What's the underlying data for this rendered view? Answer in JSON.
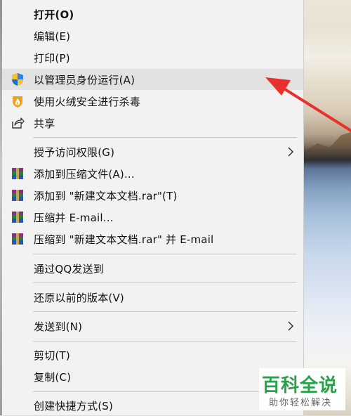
{
  "menu": {
    "items": [
      {
        "label": "打开(O)"
      },
      {
        "label": "编辑(E)"
      },
      {
        "label": "打印(P)"
      },
      {
        "label": "以管理员身份运行(A)"
      },
      {
        "label": "使用火绒安全进行杀毒"
      },
      {
        "label": "共享"
      },
      {
        "label": "授予访问权限(G)"
      },
      {
        "label": "添加到压缩文件(A)..."
      },
      {
        "label": "添加到 \"新建文本文档.rar\"(T)"
      },
      {
        "label": "压缩并 E-mail..."
      },
      {
        "label": "压缩到 \"新建文本文档.rar\" 并 E-mail"
      },
      {
        "label": "通过QQ发送到"
      },
      {
        "label": "还原以前的版本(V)"
      },
      {
        "label": "发送到(N)"
      },
      {
        "label": "剪切(T)"
      },
      {
        "label": "复制(C)"
      },
      {
        "label": "创建快捷方式(S)"
      }
    ]
  },
  "watermark": {
    "title": "百科全说",
    "subtitle": "助你轻松解决"
  },
  "colors": {
    "arrow": "#e8302c",
    "watermark_green": "#2aa24a",
    "uac_blue": "#1f6fd1",
    "uac_yellow": "#f4c430"
  },
  "icons": {
    "run_as_admin": "uac-shield-icon",
    "huorong": "huorong-flame-icon",
    "share": "share-icon",
    "winrar": "winrar-icon",
    "submenu": "chevron-right-icon"
  }
}
